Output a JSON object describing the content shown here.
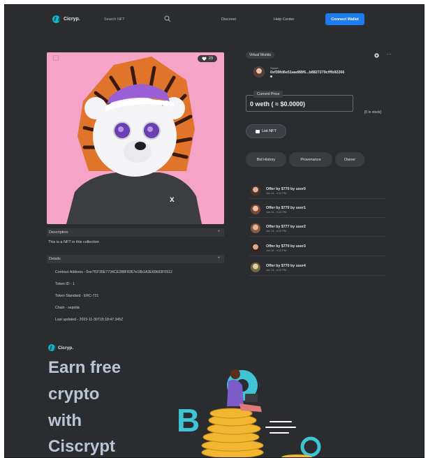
{
  "header": {
    "brand": "Cicryp.",
    "search_placeholder": "Search NFT",
    "nav": [
      "Discover",
      "Help Center"
    ],
    "connect_label": "Connect Wallet",
    "connect_color": "#1c7cf0"
  },
  "nft": {
    "likes": "23",
    "background": "#f5a3c7"
  },
  "description": {
    "heading": "Description",
    "text": "This is a NFT in this collection"
  },
  "details": {
    "heading": "Details",
    "lines": [
      "Contract Address - 0xe7f1F35E7734CE288F8367e18b1A3E60b93F0512",
      "Token ID - 1",
      "Token Standard - ERC-721",
      "Chain - sepolia",
      "Last updated - 2023-11-30T15:18:47.345Z"
    ]
  },
  "right": {
    "tag": "Virtual Worlds",
    "owner_label": "Owner",
    "owner_address": "0xf39fd6e51aad88f6...b8827279cfffb92266",
    "price_label": "Current Price",
    "price_value": "0 weth ( ≈ $0.0000)",
    "stock": "[0 in stock]",
    "list_label": "List NFT",
    "tabs": [
      "Bid History",
      "Provenance",
      "Owner"
    ]
  },
  "offers": [
    {
      "title": "Offer by $770 by user0",
      "time": "Jun 14 - 4:12 PM"
    },
    {
      "title": "Offer by $770 by user1",
      "time": "Jun 14 - 4:12 PM"
    },
    {
      "title": "Offer by $777 by user2",
      "time": "Jun 14 - 4:12 PM"
    },
    {
      "title": "Offer by $770 by user3",
      "time": "Jun 14 - 4:12 PM"
    },
    {
      "title": "Offer by $770 by user4",
      "time": "Jun 14 - 4:12 PM"
    }
  ],
  "promo": {
    "brand": "Cicryp.",
    "headline": [
      "Earn free",
      "crypto",
      "with",
      "Ciscrypt"
    ]
  }
}
